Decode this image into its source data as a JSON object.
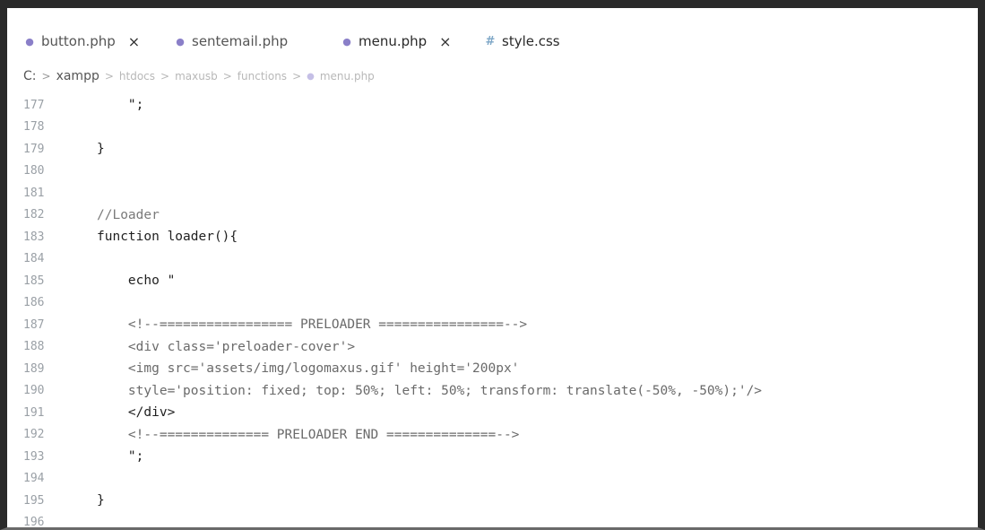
{
  "tabs": [
    {
      "label": "button.php",
      "icon": "php-elephant-icon",
      "closable": true
    },
    {
      "label": "sentemail.php",
      "icon": "php-elephant-icon",
      "closable": false
    },
    {
      "label": "menu.php",
      "icon": "php-elephant-icon",
      "closable": true
    },
    {
      "label": "style.css",
      "icon": "css-hash-icon",
      "closable": false
    }
  ],
  "tab_close_glyph": "×",
  "breadcrumb": {
    "root": "C:",
    "sep": ">",
    "part1": "xampp",
    "part2": "htdocs",
    "part3": "maxusb",
    "part4": "functions",
    "file": "menu.php"
  },
  "code_lines": [
    {
      "num": "177",
      "text": "    \";"
    },
    {
      "num": "178",
      "text": ""
    },
    {
      "num": "179",
      "text": "}"
    },
    {
      "num": "180",
      "text": ""
    },
    {
      "num": "181",
      "text": ""
    },
    {
      "num": "182",
      "text": "//Loader"
    },
    {
      "num": "183",
      "text": "function loader(){"
    },
    {
      "num": "184",
      "text": ""
    },
    {
      "num": "185",
      "text": "    echo \""
    },
    {
      "num": "186",
      "text": ""
    },
    {
      "num": "187",
      "text": "    <!--================= PRELOADER ================-->"
    },
    {
      "num": "188",
      "text": "    <div class='preloader-cover'>"
    },
    {
      "num": "189",
      "text": "    <img src='assets/img/logomaxus.gif' height='200px'"
    },
    {
      "num": "190",
      "text": "    style='position: fixed; top: 50%; left: 50%; transform: translate(-50%, -50%);'/>"
    },
    {
      "num": "191",
      "text": "    </div>"
    },
    {
      "num": "192",
      "text": "    <!--============== PRELOADER END ==============-->"
    },
    {
      "num": "193",
      "text": "    \";"
    },
    {
      "num": "194",
      "text": ""
    },
    {
      "num": "195",
      "text": "}"
    },
    {
      "num": "196",
      "text": ""
    }
  ]
}
